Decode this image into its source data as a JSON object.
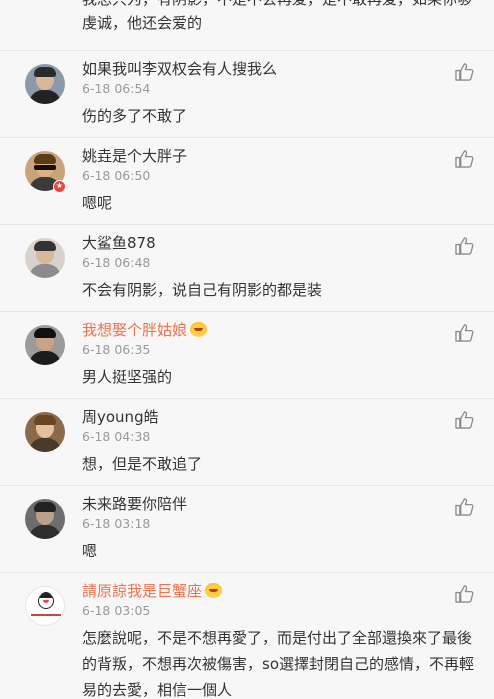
{
  "top_fragment": {
    "text": "我总只为，有阴影，不是不会再爱，是不敢再爱，如果你够虔诚，他还会爱的"
  },
  "comments": [
    {
      "name": "如果我叫李双权会有人搜我么",
      "time": "6-18 06:54",
      "text": "伤的多了不敢了",
      "name_color": "#333333",
      "badge": false,
      "avatar": "avatar-man-dark-hair"
    },
    {
      "name": "姚垚是个大胖子",
      "time": "6-18 06:50",
      "text": "嗯呢",
      "name_color": "#333333",
      "badge": true,
      "avatar": "avatar-man-sunglasses"
    },
    {
      "name": "大鲨鱼878",
      "time": "6-18 06:48",
      "text": "不会有阴影，说自己有阴影的都是装",
      "name_color": "#333333",
      "badge": false,
      "avatar": "avatar-man-light"
    },
    {
      "name": "我想娶个胖姑娘",
      "time": "6-18 06:35",
      "text": "男人挺坚强的",
      "name_color": "#eb7350",
      "badge": false,
      "crown": true,
      "avatar": "avatar-man-dark"
    },
    {
      "name": "周young皓",
      "time": "6-18 04:38",
      "text": "想，但是不敢追了",
      "name_color": "#333333",
      "badge": false,
      "avatar": "avatar-woman-brown"
    },
    {
      "name": "未来路要你陪伴",
      "time": "6-18 03:18",
      "text": "嗯",
      "name_color": "#333333",
      "badge": false,
      "avatar": "avatar-man-gray"
    },
    {
      "name": "請原諒我是巨蟹座",
      "time": "6-18 03:05",
      "text": "怎麼說呢，不是不想再愛了，而是付出了全部還換來了最後的背叛，不想再次被傷害，so選擇封閉自己的感情，不再輕易的去愛，相信一個人",
      "name_color": "#eb7350",
      "badge": false,
      "crown": true,
      "avatar": "avatar-cartoon"
    }
  ],
  "colors": {
    "vip_name": "#eb7350",
    "time": "#9a9a9a",
    "text": "#333333"
  }
}
